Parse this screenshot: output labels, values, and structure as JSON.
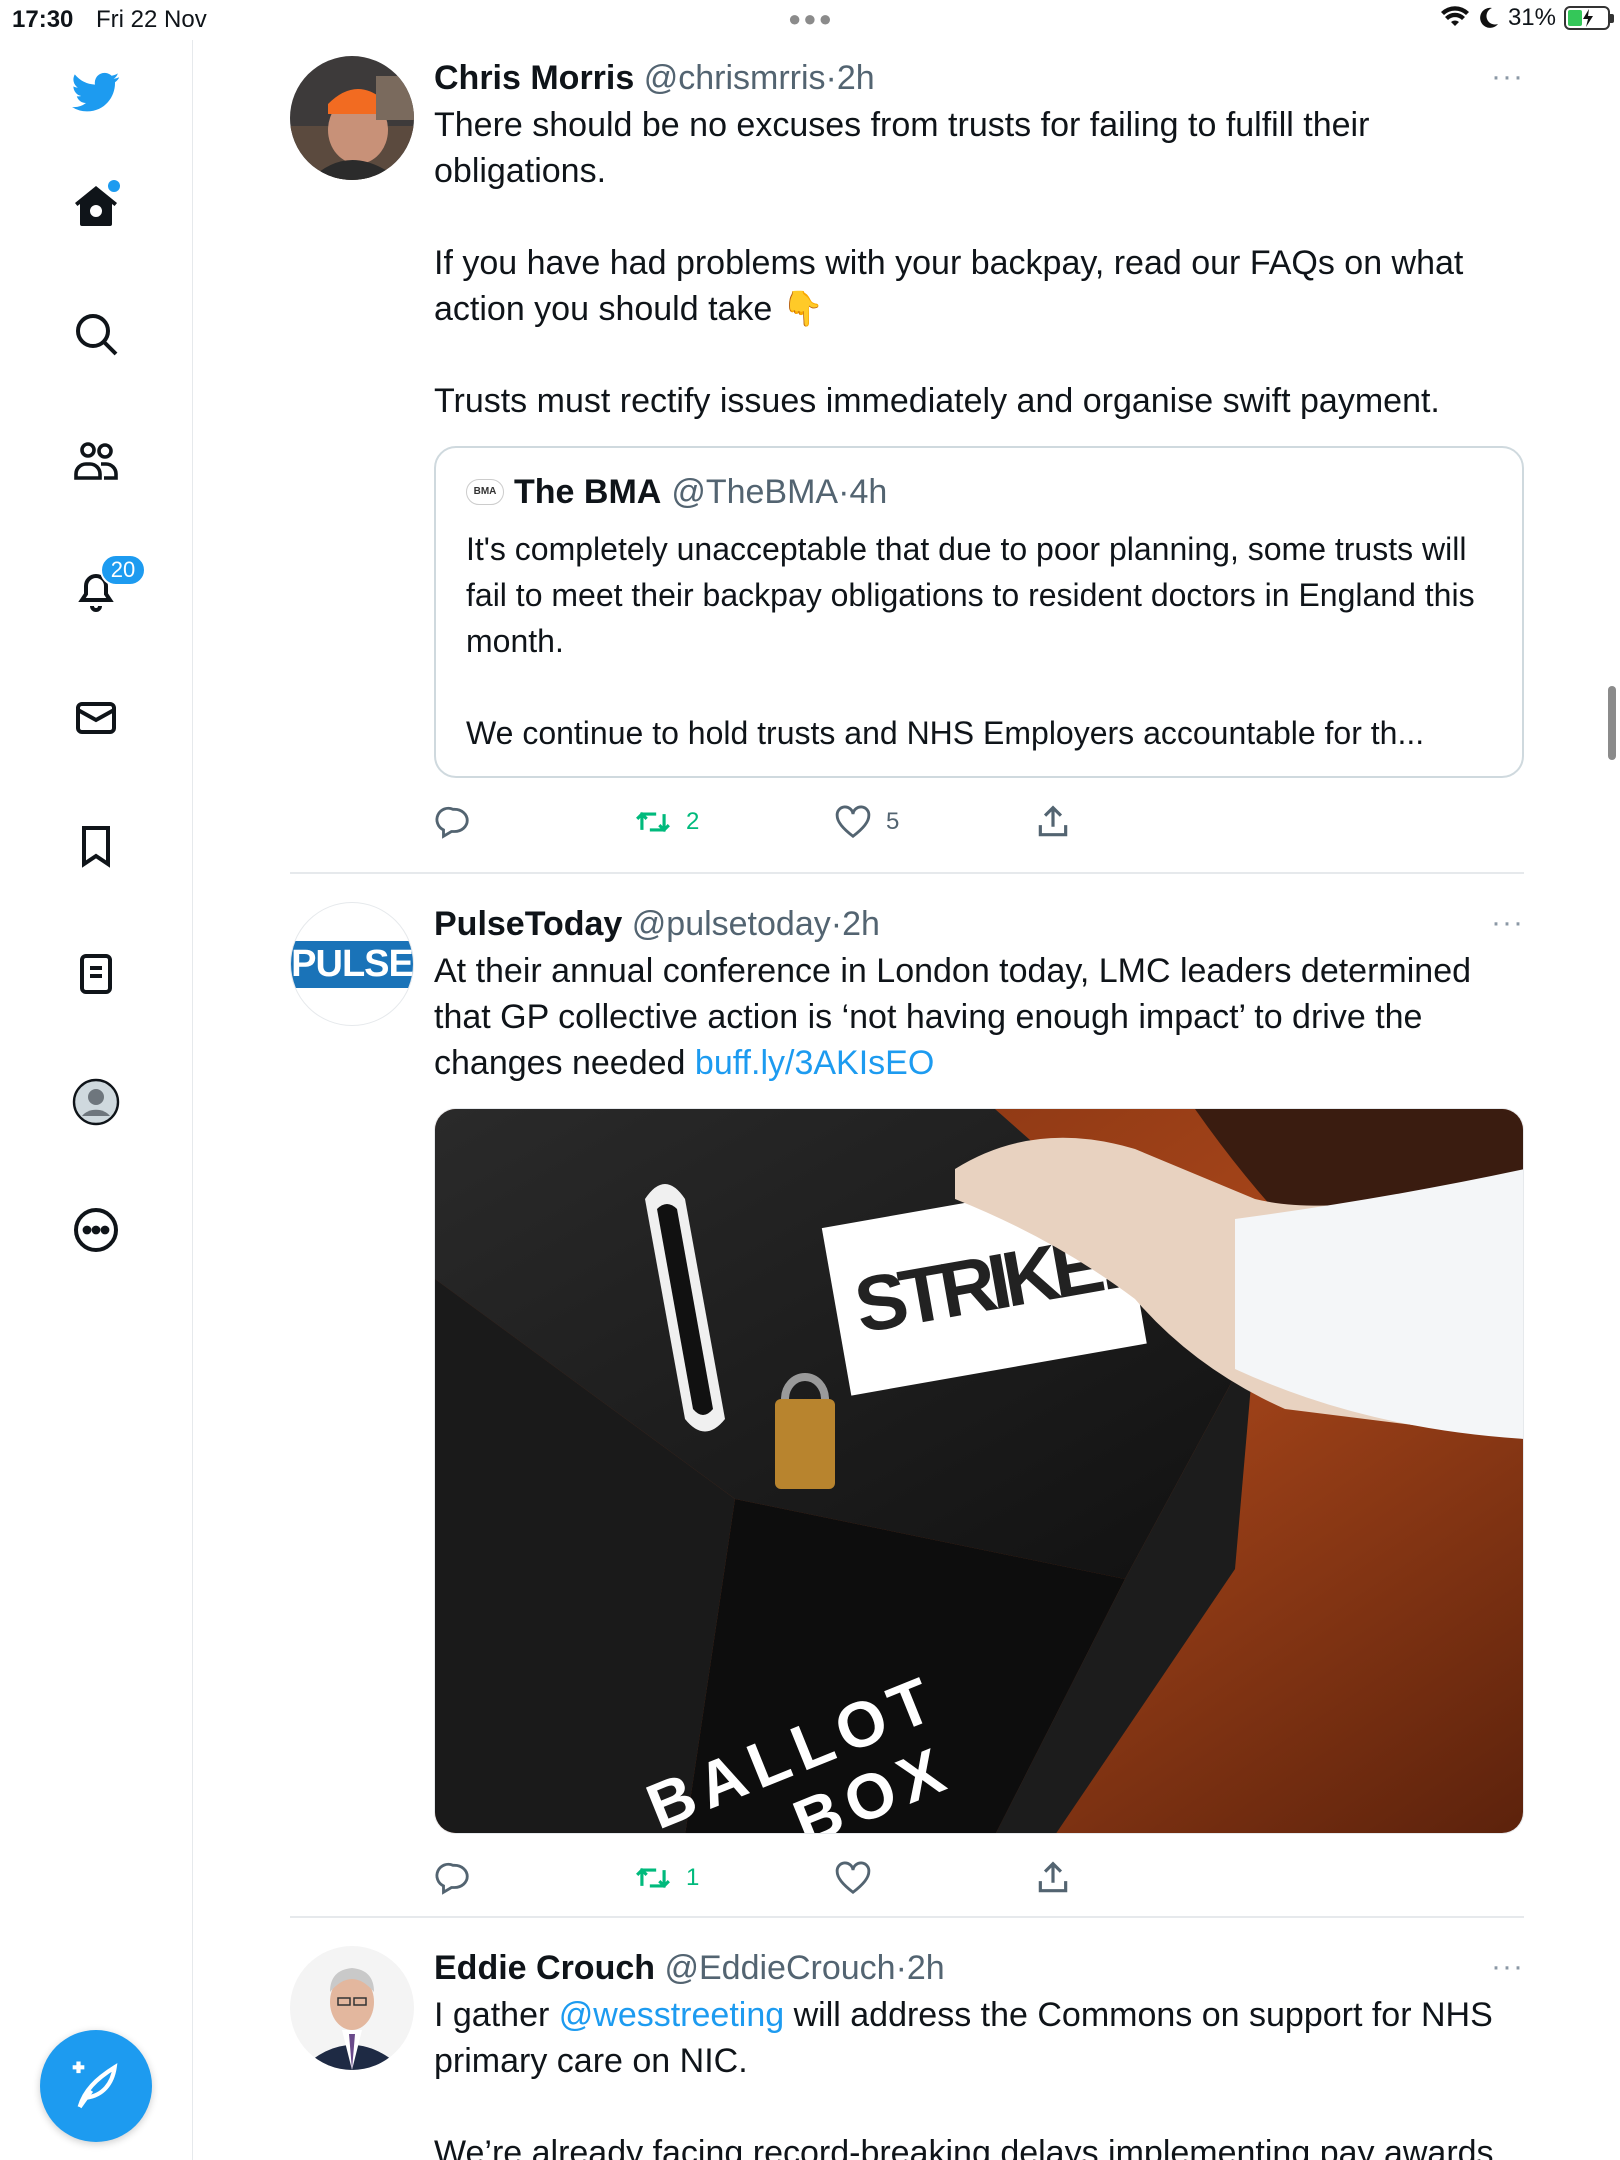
{
  "status_bar": {
    "time": "17:30",
    "date": "Fri 22 Nov",
    "battery": "31%"
  },
  "sidebar": {
    "notifications_count": "20"
  },
  "tweets": [
    {
      "name": "Chris Morris",
      "handle": "@chrismrris",
      "time": "2h",
      "paragraphs": [
        "There should be no excuses from trusts for failing to fulfill their obligations.",
        "If you have had problems with your backpay, read our FAQs on what action you should take 👇",
        "Trusts must rectify issues immediately and organise swift payment."
      ],
      "quote": {
        "logo": "BMA",
        "name": "The BMA",
        "handle": "@TheBMA",
        "time": "4h",
        "paragraphs": [
          "It's completely unacceptable that due to poor planning, some trusts will fail to meet their backpay obligations to resident doctors in England this month.",
          "We continue to hold trusts and NHS Employers accountable for th..."
        ]
      },
      "retweets": "2",
      "likes": "5"
    },
    {
      "name": "PulseToday",
      "handle": "@pulsetoday",
      "time": "2h",
      "avatar_text": "PULSE",
      "text": "At their annual conference in London today, LMC leaders determined that GP collective action is ‘not having enough impact’ to drive the changes needed ",
      "link": "buff.ly/3AKIsEO",
      "image": {
        "card_text": "STRIKE!",
        "box_text_1": "BALLOT",
        "box_text_2": "BOX"
      },
      "retweets": "1",
      "likes": ""
    },
    {
      "name": "Eddie Crouch",
      "handle": "@EddieCrouch",
      "time": "2h",
      "text_pre": "I gather ",
      "mention": "@wesstreeting",
      "text_post": " will address the Commons on support for NHS primary care on NIC.",
      "text_cut": "We’re already facing record-breaking delays implementing pay awards,"
    }
  ],
  "dot_separator": "·",
  "more_glyph": "···",
  "colors": {
    "accent": "#1d9bf0",
    "retweet": "#00ba7c",
    "muted": "#536471"
  }
}
